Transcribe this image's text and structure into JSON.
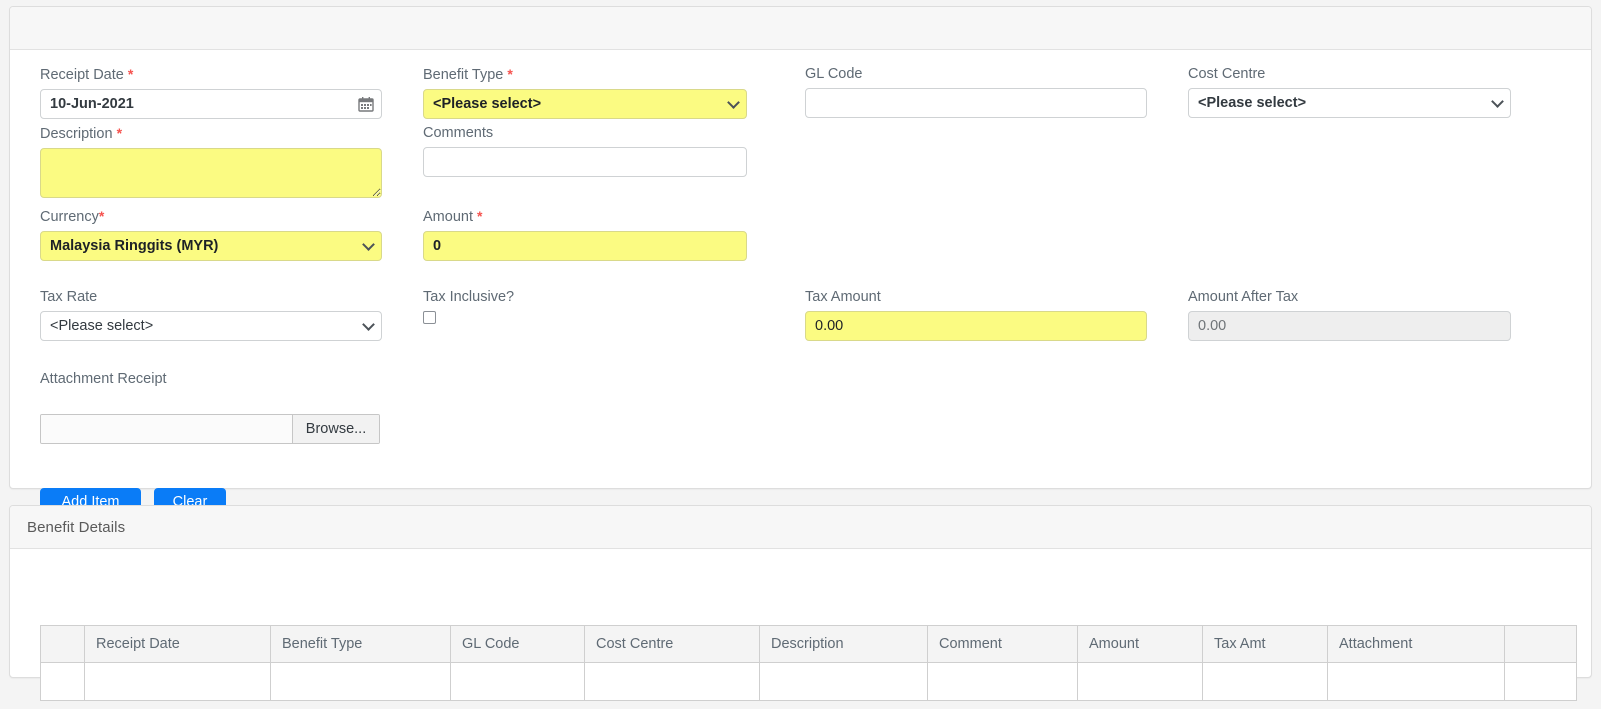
{
  "main_card": {
    "header_title": "",
    "fields": {
      "receipt_date": {
        "label": "Receipt Date",
        "required": "*",
        "value": "10-Jun-2021",
        "icon": "calendar-icon"
      },
      "benefit_type": {
        "label": "Benefit Type",
        "required": "*",
        "value": "<Please select>",
        "options": [
          "<Please select>"
        ]
      },
      "gl_code": {
        "label": "GL Code",
        "value": "",
        "placeholder": ""
      },
      "cost_centre": {
        "label": "Cost Centre",
        "value": "<Please select>",
        "options": [
          "<Please select>"
        ]
      },
      "description": {
        "label": "Description",
        "required": "*",
        "value": "",
        "placeholder": ""
      },
      "comments": {
        "label": "Comments",
        "value": "",
        "placeholder": ""
      },
      "currency": {
        "label": "Currency",
        "required": "*",
        "value": "Malaysia Ringgits (MYR)",
        "options": [
          "Malaysia Ringgits (MYR)"
        ]
      },
      "amount": {
        "label": "Amount",
        "required": "*",
        "value": "0"
      },
      "tax_rate": {
        "label": "Tax Rate",
        "value": "<Please select>",
        "options": [
          "<Please select>"
        ]
      },
      "tax_inclusive": {
        "label": "Tax Inclusive?",
        "checked": false
      },
      "tax_amount": {
        "label": "Tax Amount",
        "value": "0.00"
      },
      "amount_after_tax": {
        "label": "Amount After Tax",
        "value": "0.00"
      },
      "attachment_receipt": {
        "label": "Attachment Receipt",
        "file_name": "",
        "browse_label": "Browse..."
      }
    },
    "buttons": {
      "add_item": "Add Item",
      "clear": "Clear"
    }
  },
  "detail_card": {
    "header_title": "Benefit Details",
    "table": {
      "columns": [
        "",
        "Receipt Date",
        "Benefit Type",
        "GL Code",
        "Cost Centre",
        "Description",
        "Comment",
        "Amount",
        "Tax Amt",
        "Attachment",
        ""
      ],
      "rows": [
        [
          "",
          "",
          "",
          "",
          "",
          "",
          "",
          "",
          "",
          "",
          ""
        ]
      ]
    }
  },
  "colors": {
    "highlight_yellow": "#fbfb82",
    "required_red": "#f5534f",
    "primary_blue": "#0a7cf7",
    "label_gray": "#5f6a74",
    "card_border": "#dddddd"
  }
}
